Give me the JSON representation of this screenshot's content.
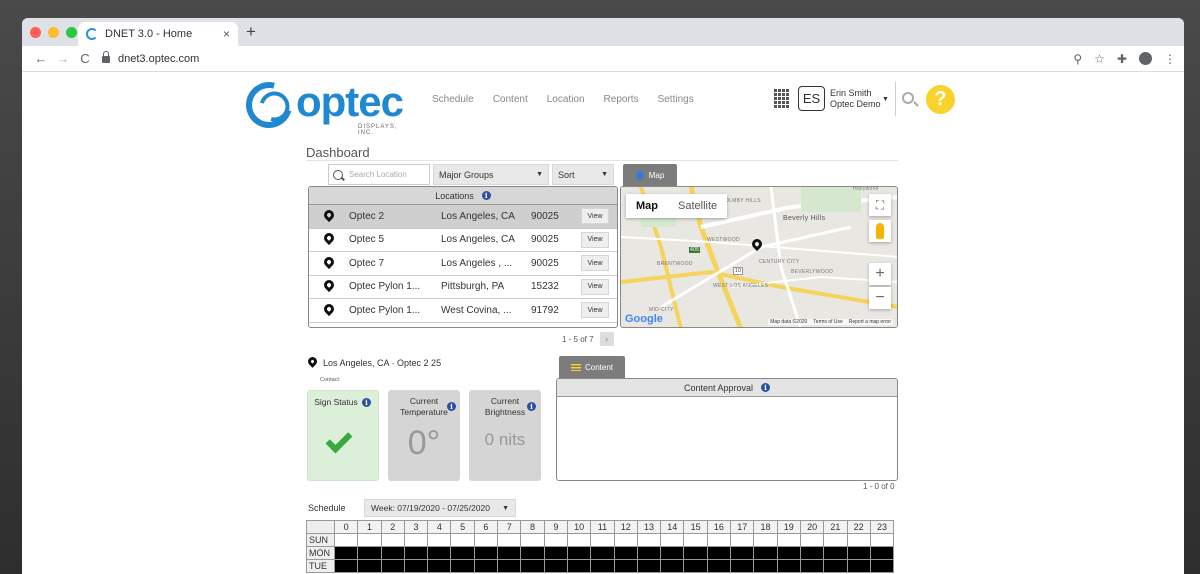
{
  "browser": {
    "tab_title": "DNET 3.0 - Home",
    "new_tab": "+",
    "tab_close": "×",
    "url": "dnet3.optec.com",
    "back": "←",
    "forward": "→",
    "reload": "C",
    "zoom": "⚲",
    "star": "☆",
    "extension": "✚",
    "menu": "⋮"
  },
  "header": {
    "logo_word": "optec",
    "logo_sub": "DISPLAYS, INC.",
    "nav": [
      "Schedule",
      "Content",
      "Location",
      "Reports",
      "Settings"
    ],
    "user_initials": "ES",
    "user_name": "Erin Smith",
    "user_org": "Optec Demo",
    "help": "?"
  },
  "dashboard": {
    "title": "Dashboard",
    "search_placeholder": "Search Location",
    "group_select": "Major Groups",
    "sort_select": "Sort",
    "map_tab": "Map",
    "locations_header": "Locations",
    "locations": [
      {
        "name": "Optec 2",
        "city": "Los Angeles, CA",
        "zip": "90025",
        "action": "View",
        "selected": true
      },
      {
        "name": "Optec 5",
        "city": "Los Angeles, CA",
        "zip": "90025",
        "action": "View",
        "selected": false
      },
      {
        "name": "Optec 7",
        "city": "Los Angeles , ...",
        "zip": "90025",
        "action": "View",
        "selected": false
      },
      {
        "name": "Optec Pylon 1...",
        "city": "Pittsburgh, PA",
        "zip": "15232",
        "action": "View",
        "selected": false
      },
      {
        "name": "Optec Pylon 1...",
        "city": "West Covina, ...",
        "zip": "91792",
        "action": "View",
        "selected": false
      }
    ],
    "pager": "1 - 5 of 7",
    "pager_next": "›"
  },
  "map": {
    "type_map": "Map",
    "type_satellite": "Satellite",
    "zoom_in": "+",
    "zoom_out": "−",
    "fullscreen": "⛶",
    "google": "Google",
    "footer": [
      "Map data ©2020",
      "Terms of Use",
      "Report a map error"
    ],
    "labels": [
      "Hollywood",
      "HOLMBY HILLS",
      "Beverly Hills",
      "WESTWOOD",
      "BRENTWOOD",
      "CENTURY CITY",
      "BEVERLYWOOD",
      "WEST LOS ANGELES",
      "MID-CITY",
      "405",
      "10"
    ]
  },
  "sign": {
    "location": "Los Angeles, CA · Optec 2 25",
    "contact": "Contact:",
    "status_label": "Sign Status",
    "temp_label_1": "Current",
    "temp_label_2": "Temperature",
    "temp_value": "0°",
    "bright_label_1": "Current",
    "bright_label_2": "Brightness",
    "bright_value": "0 nits"
  },
  "content": {
    "tab": "Content",
    "approval_header": "Content Approval",
    "pager": "1 - 0 of 0"
  },
  "schedule": {
    "label": "Schedule",
    "week": "Week: 07/19/2020 - 07/25/2020",
    "hours": [
      "0",
      "1",
      "2",
      "3",
      "4",
      "5",
      "6",
      "7",
      "8",
      "9",
      "10",
      "11",
      "12",
      "13",
      "14",
      "15",
      "16",
      "17",
      "18",
      "19",
      "20",
      "21",
      "22",
      "23"
    ],
    "days": [
      "SUN",
      "MON",
      "TUE"
    ]
  }
}
